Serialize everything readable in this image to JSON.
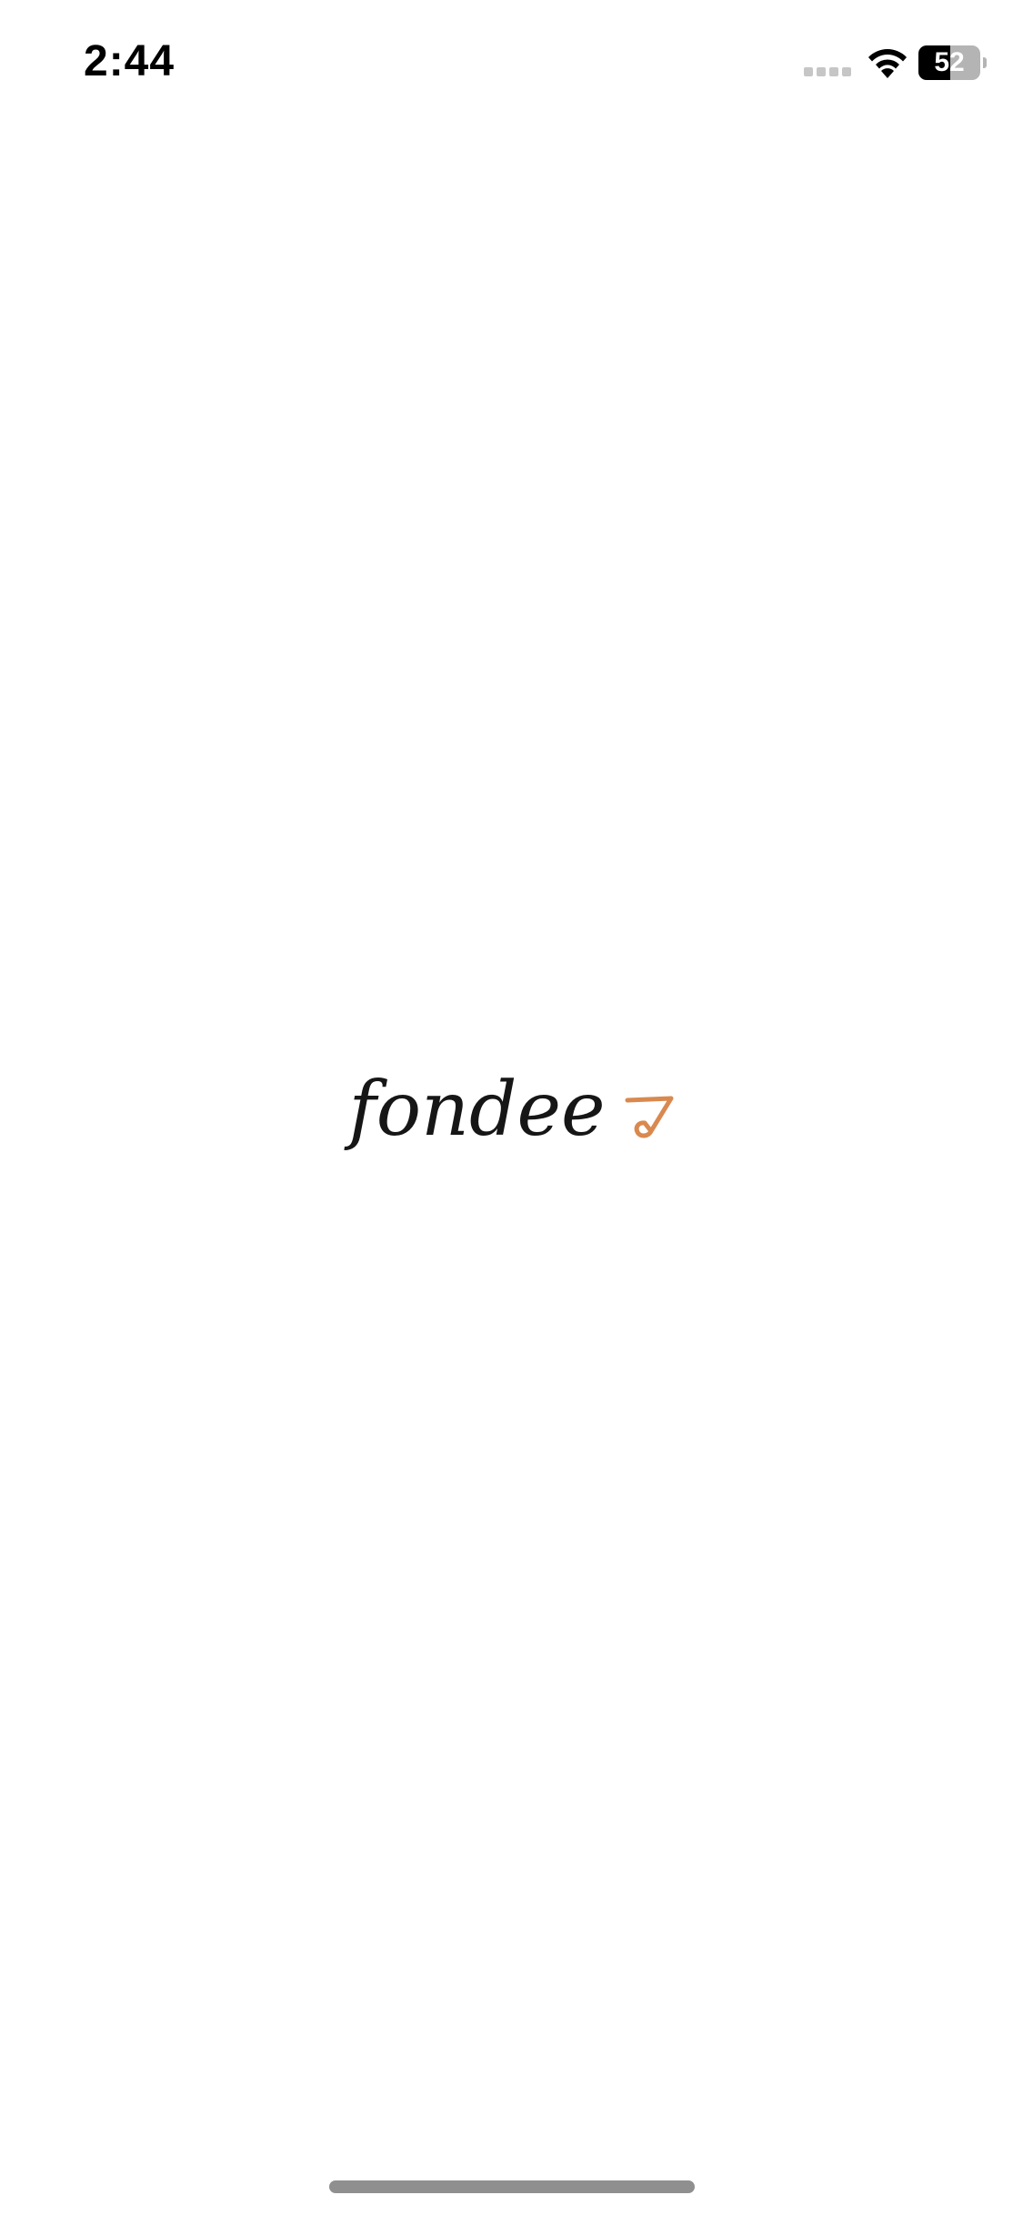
{
  "status_bar": {
    "time": "2:44",
    "battery_level": "52",
    "battery_fraction": 0.52,
    "icons": [
      "signal-icon",
      "wifi-icon",
      "battery-icon"
    ]
  },
  "logo": {
    "wordmark": "fondee",
    "mark_icon": "paper-plane-icon",
    "mark_color": "#D9894F"
  },
  "colors": {
    "background": "#FFFFFF",
    "text": "#161616",
    "home_indicator": "#8F8F8F"
  }
}
